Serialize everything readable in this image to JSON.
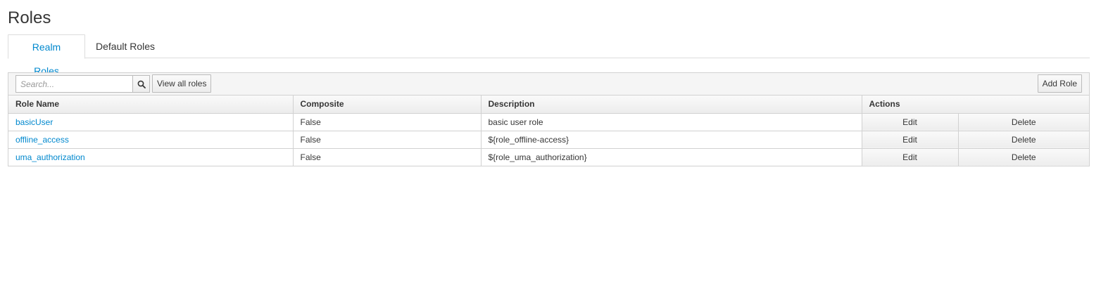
{
  "page": {
    "title": "Roles"
  },
  "tabs": [
    {
      "label": "Realm Roles",
      "active": true
    },
    {
      "label": "Default Roles",
      "active": false
    }
  ],
  "toolbar": {
    "search_placeholder": "Search...",
    "search_icon": "search-icon",
    "view_all_label": "View all roles",
    "add_role_label": "Add Role"
  },
  "table": {
    "headers": {
      "role_name": "Role Name",
      "composite": "Composite",
      "description": "Description",
      "actions": "Actions"
    },
    "rows": [
      {
        "name": "basicUser",
        "composite": "False",
        "description": "basic user role",
        "edit": "Edit",
        "delete": "Delete"
      },
      {
        "name": "offline_access",
        "composite": "False",
        "description": "${role_offline-access}",
        "edit": "Edit",
        "delete": "Delete"
      },
      {
        "name": "uma_authorization",
        "composite": "False",
        "description": "${role_uma_authorization}",
        "edit": "Edit",
        "delete": "Delete"
      }
    ]
  },
  "colors": {
    "link": "#0088ce",
    "border": "#d1d1d1",
    "text": "#363636"
  }
}
